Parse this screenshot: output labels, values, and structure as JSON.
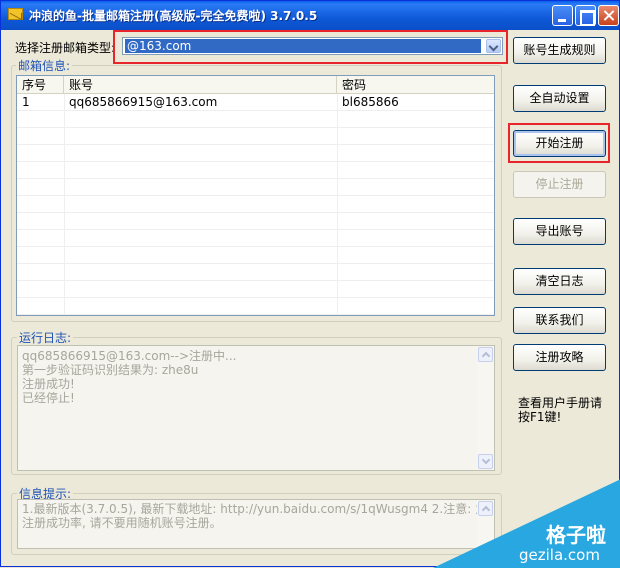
{
  "window": {
    "title": "冲浪的鱼-批量邮箱注册(高级版-完全免费啦) 3.7.0.5"
  },
  "email_type": {
    "label": "选择注册邮箱类型:",
    "selected": "@163.com"
  },
  "mailbox_info": {
    "label": "邮箱信息:",
    "columns": [
      "序号",
      "账号",
      "密码"
    ],
    "rows": [
      {
        "index": "1",
        "account": "qq685866915@163.com",
        "password": "bl685866"
      }
    ]
  },
  "run_log": {
    "label": "运行日志:",
    "lines": [
      "qq685866915@163.com-->注册中...",
      "第一步验证码识别结果为: zhe8u",
      "注册成功!",
      "已经停止!"
    ]
  },
  "info_tips": {
    "label": "信息提示:",
    "lines": [
      "1.最新版本(3.7.0.5), 最新下载地址: http://yun.baidu.com/s/1qWusgm4 2.注意: 为保证",
      "注册成功率, 请不要用随机账号注册。"
    ]
  },
  "buttons": {
    "account_rules": "账号生成规则",
    "auto_settings": "全自动设置",
    "start_register": "开始注册",
    "stop_register": "停止注册",
    "export_accounts": "导出账号",
    "clear_log": "清空日志",
    "contact_us": "联系我们",
    "register_guide": "注册攻略"
  },
  "manual_hint": "查看用户手册请按F1键!",
  "watermark": {
    "title": "格子啦",
    "site": "gezila.com"
  },
  "colors": {
    "titlebar": "#0a5ee9",
    "highlight_box": "#e8252b",
    "group_label": "#1e53b7",
    "selection": "#316ac5"
  }
}
